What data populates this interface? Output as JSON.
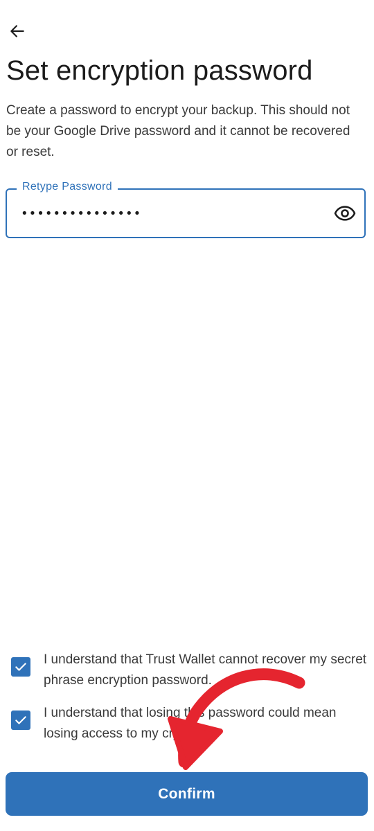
{
  "header": {
    "back_icon": "arrow-left-icon",
    "title": "Set encryption password",
    "description": "Create a password to encrypt your backup. This should not be your Google Drive password and it cannot be recovered or reset."
  },
  "password_field": {
    "label": "Retype Password",
    "value": "•••••••••••••••",
    "toggle_icon": "eye-icon"
  },
  "acknowledgements": [
    {
      "checked": true,
      "text": "I understand that Trust Wallet cannot recover my secret phrase encryption password."
    },
    {
      "checked": true,
      "text": "I understand that losing this password could mean losing access to my crypto."
    }
  ],
  "confirm_label": "Confirm",
  "colors": {
    "accent": "#2f72b9",
    "annotation_arrow": "#e5252f",
    "text": "#3a3a3a",
    "background": "#ffffff"
  }
}
